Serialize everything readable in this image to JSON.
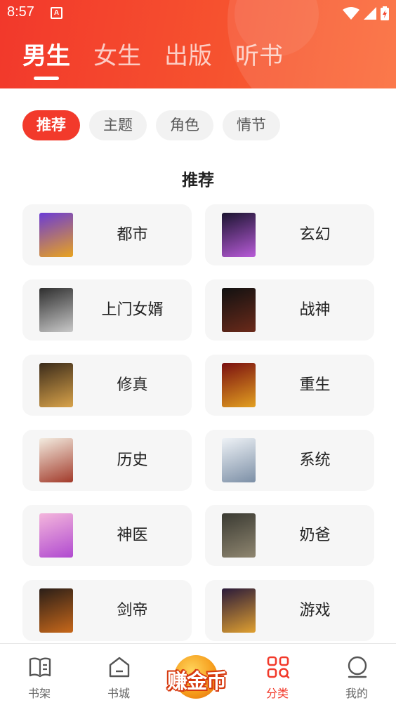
{
  "status_bar": {
    "time": "8:57",
    "app_badge": "A"
  },
  "top_tabs": [
    {
      "label": "男生",
      "active": true
    },
    {
      "label": "女生",
      "active": false
    },
    {
      "label": "出版",
      "active": false
    },
    {
      "label": "听书",
      "active": false
    }
  ],
  "chips": [
    {
      "label": "推荐",
      "active": true
    },
    {
      "label": "主题",
      "active": false
    },
    {
      "label": "角色",
      "active": false
    },
    {
      "label": "情节",
      "active": false
    }
  ],
  "section_title": "推荐",
  "categories": [
    {
      "label": "都市",
      "cover_text": "",
      "cover_colors": [
        "#6a3bd6",
        "#e9a31f"
      ]
    },
    {
      "label": "玄幻",
      "cover_text": "",
      "cover_colors": [
        "#1b1430",
        "#b85bd8"
      ]
    },
    {
      "label": "上门女婿",
      "cover_text": "",
      "cover_colors": [
        "#2e2e2e",
        "#c9c9c9"
      ]
    },
    {
      "label": "战神",
      "cover_text": "",
      "cover_colors": [
        "#111111",
        "#6b2a1a"
      ]
    },
    {
      "label": "修真",
      "cover_text": "",
      "cover_colors": [
        "#3b2b1a",
        "#d9a34a"
      ]
    },
    {
      "label": "重生",
      "cover_text": "",
      "cover_colors": [
        "#7a1010",
        "#e3a020"
      ]
    },
    {
      "label": "历史",
      "cover_text": "",
      "cover_colors": [
        "#f3ece0",
        "#a23a2a"
      ]
    },
    {
      "label": "系统",
      "cover_text": "",
      "cover_colors": [
        "#eef2f6",
        "#7c8fa6"
      ]
    },
    {
      "label": "神医",
      "cover_text": "",
      "cover_colors": [
        "#f4b6dc",
        "#b04ad0"
      ]
    },
    {
      "label": "奶爸",
      "cover_text": "",
      "cover_colors": [
        "#3a3a32",
        "#8f8670"
      ]
    },
    {
      "label": "剑帝",
      "cover_text": "",
      "cover_colors": [
        "#2a1e18",
        "#c8681a"
      ]
    },
    {
      "label": "游戏",
      "cover_text": "",
      "cover_colors": [
        "#2a1a3a",
        "#e0a030"
      ]
    }
  ],
  "bottom_nav": [
    {
      "label": "书架",
      "icon": "bookshelf-icon",
      "active": false
    },
    {
      "label": "书城",
      "icon": "home-icon",
      "active": false
    },
    {
      "label": "分类",
      "icon": "category-icon",
      "active": true
    },
    {
      "label": "我的",
      "icon": "profile-icon",
      "active": false
    }
  ],
  "coin_button": {
    "label": "赚金币"
  },
  "colors": {
    "accent": "#f23a2b",
    "header_start": "#f2382b",
    "header_end": "#fb6a37"
  }
}
